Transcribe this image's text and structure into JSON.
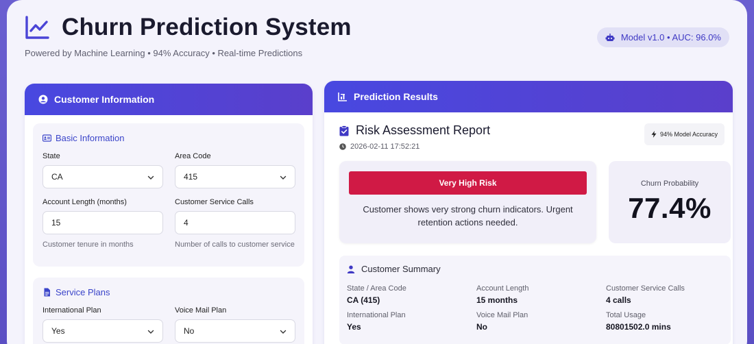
{
  "header": {
    "title": "Churn Prediction System",
    "subtitle": "Powered by Machine Learning • 94% Accuracy • Real-time Predictions",
    "model_badge": "Model v1.0 • AUC: 96.0%"
  },
  "left_panel": {
    "title": "Customer Information",
    "basic": {
      "title": "Basic Information",
      "state_label": "State",
      "state_value": "CA",
      "area_label": "Area Code",
      "area_value": "415",
      "account_label": "Account Length (months)",
      "account_value": "15",
      "account_help": "Customer tenure in months",
      "calls_label": "Customer Service Calls",
      "calls_value": "4",
      "calls_help": "Number of calls to customer service"
    },
    "plans": {
      "title": "Service Plans",
      "intl_label": "International Plan",
      "intl_value": "Yes",
      "vmail_label": "Voice Mail Plan",
      "vmail_value": "No"
    }
  },
  "right_panel": {
    "title": "Prediction Results",
    "report_title": "Risk Assessment Report",
    "timestamp": "2026-02-11 17:52:21",
    "accuracy_chip": "94% Model Accuracy",
    "risk_level": "Very High Risk",
    "risk_message": "Customer shows very strong churn indicators. Urgent retention actions needed.",
    "probability_label": "Churn Probability",
    "probability_value": "77.4%",
    "summary": {
      "title": "Customer Summary",
      "items": [
        {
          "label": "State / Area Code",
          "value": "CA (415)"
        },
        {
          "label": "Account Length",
          "value": "15 months"
        },
        {
          "label": "Customer Service Calls",
          "value": "4 calls"
        },
        {
          "label": "International Plan",
          "value": "Yes"
        },
        {
          "label": "Voice Mail Plan",
          "value": "No"
        },
        {
          "label": "Total Usage",
          "value": "80801502.0 mins"
        }
      ]
    }
  },
  "colors": {
    "accent": "#4848e0",
    "risk": "#d01a45",
    "background": "#f4f3fc"
  }
}
